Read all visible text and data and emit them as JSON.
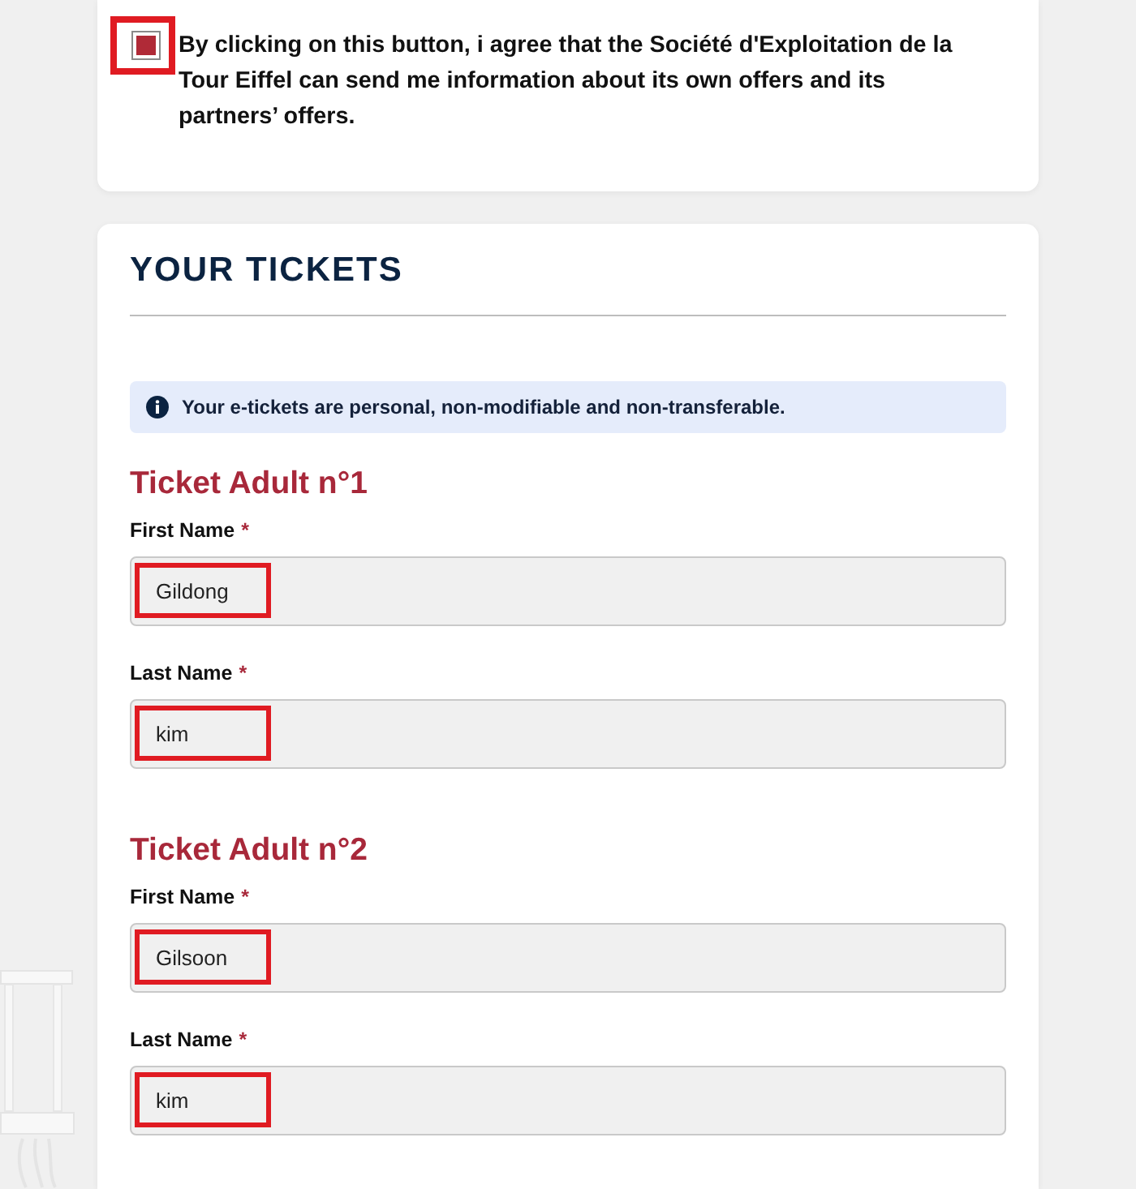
{
  "consent": {
    "checked": true,
    "highlighted": true,
    "text": "By clicking on this button, i agree that the Société d'Exploitation de la Tour Eiffel can send me information about its own offers and its partners’ offers."
  },
  "tickets_section": {
    "title": "YOUR TICKETS",
    "notice": "Your e-tickets are personal, non-modifiable and non-transferable.",
    "tickets": [
      {
        "title": "Ticket Adult n°1",
        "fields": [
          {
            "label": "First Name",
            "required_mark": "*",
            "value": "Gildong",
            "highlighted": true
          },
          {
            "label": "Last Name",
            "required_mark": "*",
            "value": "kim",
            "highlighted": true
          }
        ]
      },
      {
        "title": "Ticket Adult n°2",
        "fields": [
          {
            "label": "First Name",
            "required_mark": "*",
            "value": "Gilsoon",
            "highlighted": true
          },
          {
            "label": "Last Name",
            "required_mark": "*",
            "value": "kim",
            "highlighted": true
          }
        ]
      }
    ]
  }
}
